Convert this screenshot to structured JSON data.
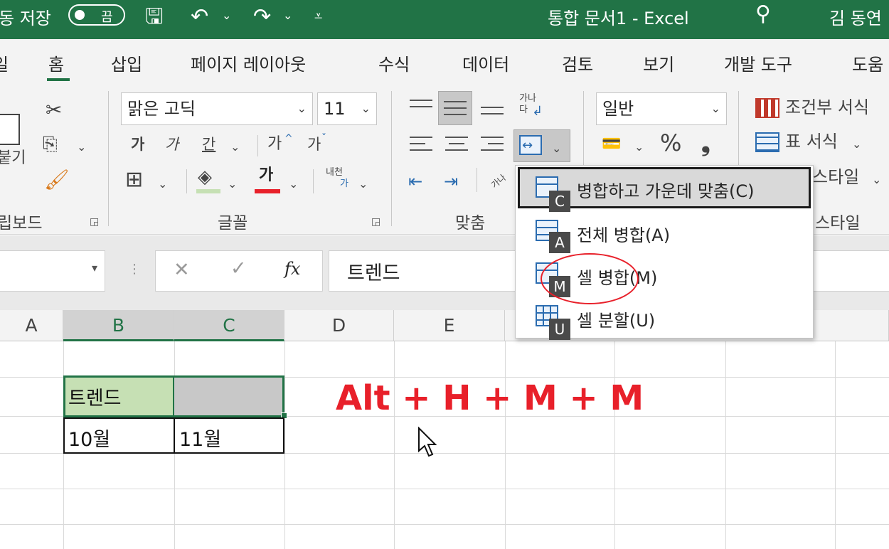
{
  "titlebar": {
    "autosave_label": "동 저장",
    "toggle_state": "끔",
    "doc_title": "통합 문서1  -  Excel",
    "user_name": "김 동연"
  },
  "tabs": [
    "홈",
    "삽입",
    "페이지 레이아웃",
    "수식",
    "데이터",
    "검토",
    "보기",
    "개발 도구",
    "도움"
  ],
  "ribbon": {
    "clipboard": {
      "paste_label": "붙기",
      "group_label": "립보드"
    },
    "font": {
      "font_name": "맑은 고딕",
      "font_size": "11",
      "bold": "가",
      "italic": "가",
      "underline": "간",
      "grow": "가",
      "shrink": "가",
      "font_color_glyph": "가",
      "phonetic_top": "내천",
      "phonetic_bottom": "가",
      "group_label": "글꼴"
    },
    "alignment": {
      "wrap_top": "가나",
      "wrap_bottom": "다",
      "orient_glyph": "가나",
      "group_label": "맞춤"
    },
    "number": {
      "format": "일반",
      "percent": "%",
      "comma": "❟"
    },
    "styles": {
      "conditional": "조건부 서식",
      "table": "표 서식",
      "cell_styles": "스타일",
      "group_label": "스타일"
    }
  },
  "formula_bar": {
    "content": "트렌드",
    "fx": "fx",
    "cancel": "✕",
    "enter": "✓"
  },
  "columns": [
    "A",
    "B",
    "C",
    "D",
    "E"
  ],
  "cells": {
    "B2": "트렌드",
    "B3": "10월",
    "C3": "11월"
  },
  "annotation": "Alt  +  H  +  M  +  M",
  "menu": {
    "items": [
      {
        "label": "병합하고 가운데 맞춤(C)",
        "keytip": "C"
      },
      {
        "label": "전체 병합(A)",
        "keytip": "A"
      },
      {
        "label": "셀 병합(M)",
        "keytip": "M"
      },
      {
        "label": "셀 분할(U)",
        "keytip": "U"
      }
    ]
  },
  "colors": {
    "excel_green": "#217346",
    "selection_fill": "#c6e0b4",
    "annotation_red": "#e8202a",
    "menu_highlight": "#d9d9d9"
  }
}
